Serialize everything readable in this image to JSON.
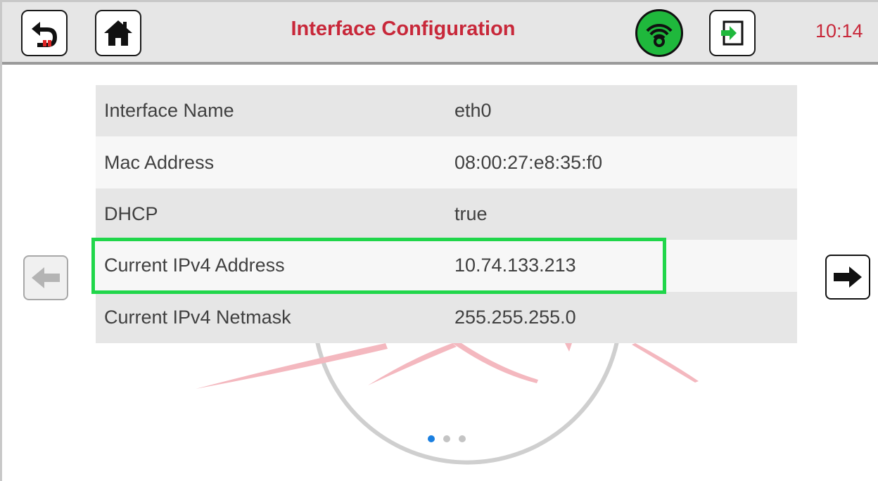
{
  "header": {
    "title": "Interface Configuration",
    "time": "10:14",
    "icons": {
      "back": "back-arrow-icon",
      "home": "home-icon",
      "wifi": "wifi-icon",
      "exit": "exit-door-icon"
    },
    "colors": {
      "title": "#c8283a",
      "wifi_status": "#1fb83c",
      "exit_arrow": "#1fb83c"
    }
  },
  "interface": {
    "rows": [
      {
        "label": "Interface Name",
        "value": "eth0"
      },
      {
        "label": "Mac Address",
        "value": "08:00:27:e8:35:f0"
      },
      {
        "label": "DHCP",
        "value": "true"
      },
      {
        "label": "Current IPv4 Address",
        "value": "10.74.133.213"
      },
      {
        "label": "Current IPv4 Netmask",
        "value": "255.255.255.0"
      }
    ],
    "highlighted_row": "Current IPv4 Address",
    "highlight_color": "#20d64a"
  },
  "pagination": {
    "page_count": 3,
    "current_page": 1,
    "prev_enabled": false,
    "next_enabled": true
  }
}
